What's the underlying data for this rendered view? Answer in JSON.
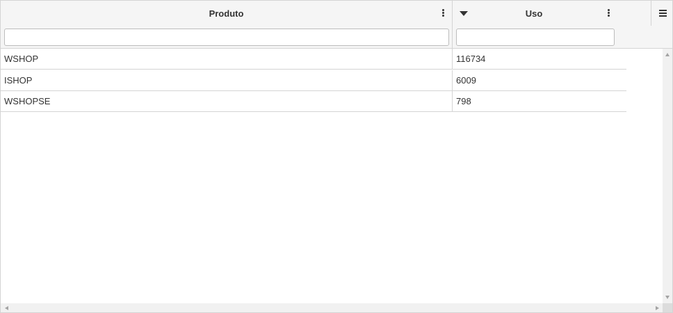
{
  "grid": {
    "columns": [
      {
        "title": "Produto",
        "filter_value": "",
        "filter_placeholder": ""
      },
      {
        "title": "Uso",
        "filter_value": "",
        "filter_placeholder": "",
        "sort": "descending"
      }
    ],
    "rows": [
      {
        "produto": "WSHOP",
        "uso": "116734"
      },
      {
        "produto": "ISHOP",
        "uso": "6009"
      },
      {
        "produto": "WSHOPSE",
        "uso": "798"
      }
    ],
    "icons": {
      "column_menu": "kebab-icon",
      "sort": "sort-descending-icon",
      "grid_menu": "hamburger-menu-icon"
    },
    "colors": {
      "header_bg": "#f5f5f5",
      "border": "#d4d4d4",
      "text": "#333333"
    }
  }
}
